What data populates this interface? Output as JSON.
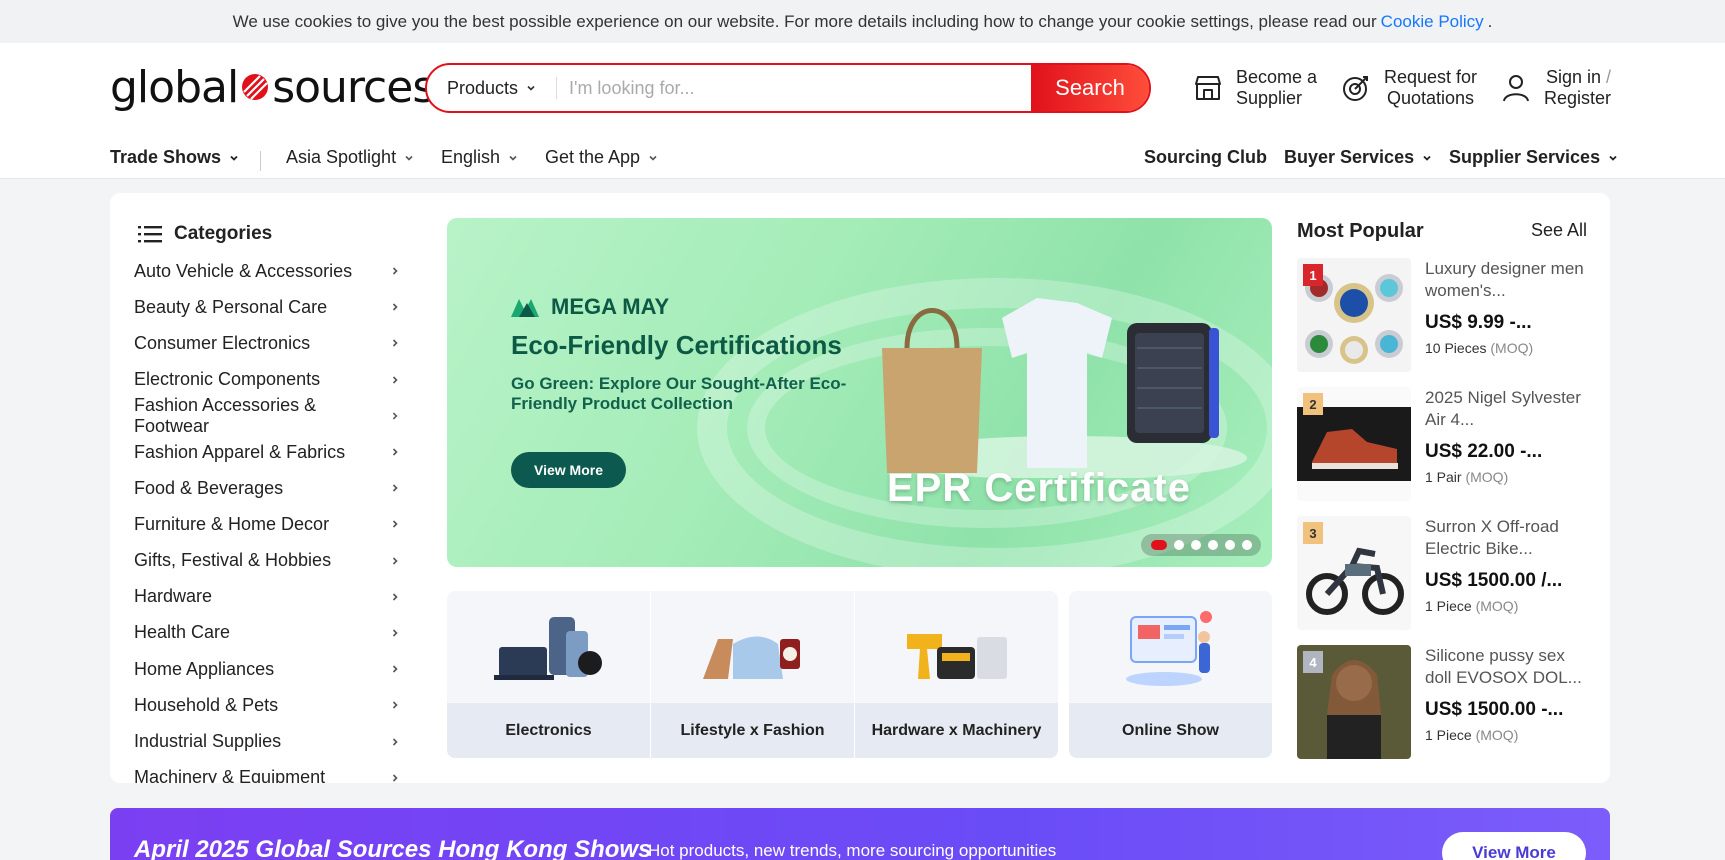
{
  "cookie": {
    "text": "We use cookies to give you the best possible experience on our website. For more details including how to change your cookie settings, please read our",
    "link": "Cookie Policy",
    "end": "."
  },
  "logo": {
    "left": "global",
    "right": "sources"
  },
  "search": {
    "category": "Products",
    "placeholder": "I'm looking for...",
    "button": "Search"
  },
  "header_links": {
    "supplier_line1": "Become a",
    "supplier_line2": "Supplier",
    "rfq_line1": "Request for",
    "rfq_line2": "Quotations",
    "signin": "Sign in",
    "slash": "/",
    "register": "Register"
  },
  "nav": {
    "trade_shows": "Trade Shows",
    "asia_spotlight": "Asia Spotlight",
    "english": "English",
    "get_app": "Get the App",
    "sourcing_club": "Sourcing Club",
    "buyer_services": "Buyer Services",
    "supplier_services": "Supplier Services"
  },
  "categories": {
    "title": "Categories",
    "items": [
      "Auto Vehicle & Accessories",
      "Beauty & Personal Care",
      "Consumer Electronics",
      "Electronic Components",
      "Fashion Accessories & Footwear",
      "Fashion Apparel & Fabrics",
      "Food & Beverages",
      "Furniture & Home Decor",
      "Gifts, Festival & Hobbies",
      "Hardware",
      "Health Care",
      "Home Appliances",
      "Household & Pets",
      "Industrial Supplies",
      "Machinery & Equipment"
    ]
  },
  "banner": {
    "brand": "MEGA MAY",
    "title": "Eco-Friendly Certifications",
    "subtitle": "Go Green: Explore Our Sought-After Eco-Friendly Product Collection",
    "button": "View More",
    "badge": "EPR Certificate",
    "slides": 6,
    "active_slide": 1
  },
  "tiles": [
    "Electronics",
    "Lifestyle x Fashion",
    "Hardware x Machinery",
    "Online Show"
  ],
  "popular": {
    "title": "Most Popular",
    "see_all": "See All",
    "items": [
      {
        "rank": "1",
        "name": "Luxury designer men women's...",
        "price": "US$ 9.99 -...",
        "qty": "10 Pieces",
        "moq": "(MOQ)",
        "rank_color": "#d9262b"
      },
      {
        "rank": "2",
        "name": "2025 Nigel Sylvester Air 4...",
        "price": "US$ 22.00 -...",
        "qty": "1 Pair",
        "moq": "(MOQ)",
        "rank_color": "#f1c27d"
      },
      {
        "rank": "3",
        "name": "Surron X Off-road Electric Bike...",
        "price": "US$ 1500.00  /...",
        "qty": "1 Piece",
        "moq": "(MOQ)",
        "rank_color": "#f1c27d"
      },
      {
        "rank": "4",
        "name": "Silicone pussy sex doll EVOSOX DOL...",
        "price": "US$ 1500.00 -...",
        "qty": "1 Piece",
        "moq": "(MOQ)",
        "rank_color": "#b0b6c0"
      }
    ]
  },
  "hk_banner": {
    "title": "April 2025 Global Sources Hong Kong Shows",
    "subtitle": "Hot products, new trends, more sourcing opportunities",
    "button": "View More"
  },
  "colors": {
    "accent": "#e0111b",
    "link": "#1677ff",
    "banner_dark": "#0c5a46",
    "purple": "#6a4cf7"
  }
}
